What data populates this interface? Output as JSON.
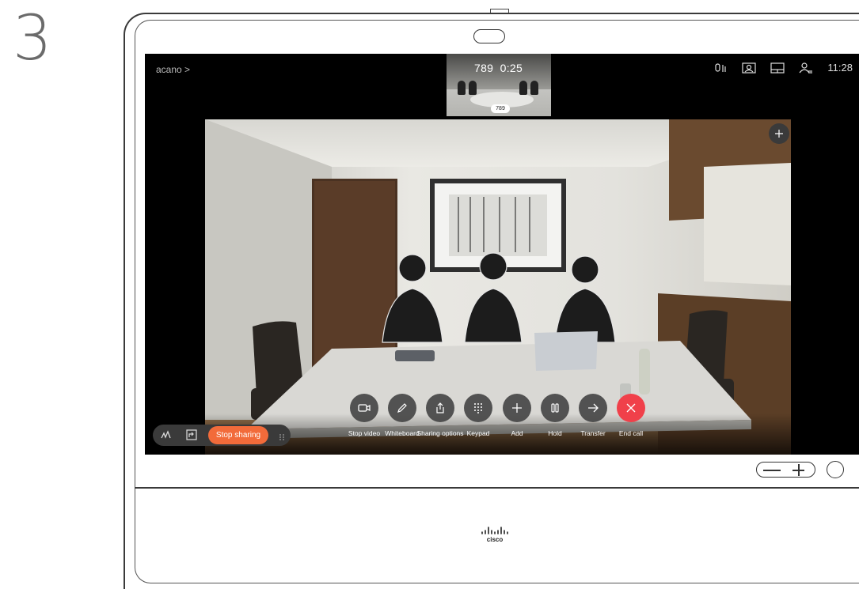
{
  "step_number": "3",
  "top_bar": {
    "brand": "acano >",
    "call_number": "789",
    "call_timer": "0:25",
    "selfview_label": "789",
    "clock": "11:28"
  },
  "share_bar": {
    "stop_sharing_label": "Stop sharing"
  },
  "call_controls": [
    {
      "label": "Stop video",
      "icon": "camera-icon"
    },
    {
      "label": "Whiteboard",
      "icon": "pen-icon"
    },
    {
      "label": "Sharing options",
      "icon": "share-icon"
    },
    {
      "label": "Keypad",
      "icon": "keypad-icon"
    },
    {
      "label": "Add",
      "icon": "plus-icon"
    },
    {
      "label": "Hold",
      "icon": "pause-icon"
    },
    {
      "label": "Transfer",
      "icon": "arrow-right-icon"
    },
    {
      "label": "End call",
      "icon": "close-icon"
    }
  ],
  "colors": {
    "stop_sharing": "#f26b3a",
    "end_call": "#f0404a",
    "control_bg": "#464646"
  },
  "logo_text": "cisco"
}
